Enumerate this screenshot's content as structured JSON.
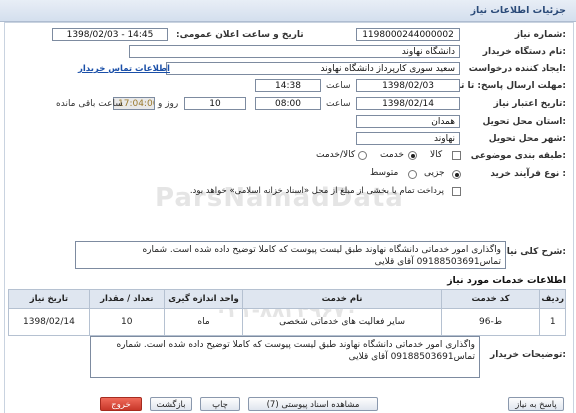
{
  "page": {
    "title": "جزئیات اطلاعات نیاز"
  },
  "watermark": {
    "text": "ParsNamadData",
    "sub": "پایگاه اطلاع رسانی مناقصه و مزایده",
    "phone": "۰۲۱-۸۸۳۴۹۶۷۰"
  },
  "form": {
    "need_number": {
      "label": "شماره نیاز:",
      "value": "1198000244000002"
    },
    "announce_datetime": {
      "label": "تاریخ و ساعت اعلان عمومی:",
      "value": "1398/02/03 - 14:45"
    },
    "buyer_org": {
      "label": "نام دستگاه خریدار:",
      "value": "دانشگاه نهاوند"
    },
    "requester": {
      "label": "ایجاد کننده درخواست:",
      "value": "سعید سوری کارپرداز دانشگاه نهاوند",
      "contact_link": "اطلاعات تماس خریدار"
    },
    "reply_deadline": {
      "label": "مهلت ارسال پاسخ: تا تاریخ:",
      "date": "1398/02/03",
      "time_label": "ساعت",
      "time": "14:38"
    },
    "validity_deadline": {
      "label": "تاریخ اعتبار نیاز:",
      "date": "1398/02/14",
      "time_label": "ساعت",
      "time": "08:00",
      "days": "10",
      "days_label": "روز و",
      "remaining": "17:04:00",
      "remaining_label": "ساعت باقی مانده"
    },
    "delivery_province": {
      "label": "استان محل تحویل:",
      "value": "همدان"
    },
    "delivery_city": {
      "label": "شهر محل تحویل:",
      "value": "نهاوند"
    },
    "category": {
      "label": "طبقه بندی موضوعی:",
      "options": [
        "کالا",
        "خدمت",
        "کالا/خدمت"
      ],
      "selected": "خدمت"
    },
    "process_type": {
      "label": "نوع فرآیند خرید :",
      "options": [
        "جزیی",
        "متوسط"
      ],
      "selected": "جزیی"
    },
    "payment_note": "پرداخت تمام یا بخشی از مبلغ از محل «اسناد خزانه اسلامی» خواهد بود."
  },
  "need_description": {
    "label": "شرح کلی نیاز:",
    "text": "واگذاری امور خدماتی دانشگاه نهاوند طبق لیست پیوست که کاملا توضیح داده شده است. شماره تماس09188503691 آقای قلایی"
  },
  "services": {
    "section_title": "اطلاعات خدمات مورد نیاز",
    "columns": [
      "ردیف",
      "کد خدمت",
      "نام خدمت",
      "واحد اندازه گیری",
      "تعداد / مقدار",
      "تاریخ نیاز"
    ],
    "rows": [
      {
        "row": "1",
        "code": "ط-96",
        "name": "سایر فعالیت های خدماتی شخصی",
        "unit": "ماه",
        "qty": "10",
        "date": "1398/02/14"
      }
    ]
  },
  "buyer_notes": {
    "label": "توضیحات خریدار:",
    "text": "واگذاری امور خدماتی دانشگاه نهاوند طبق لیست پیوست که کاملا توضیح داده شده است. شماره تماس09188503691 آقای قلایی"
  },
  "buttons": {
    "reply": "پاسخ به نیاز",
    "view_docs": "مشاهده اسناد پیوستی (7)",
    "print": "چاپ",
    "back": "بازگشت",
    "exit": "خروج"
  }
}
